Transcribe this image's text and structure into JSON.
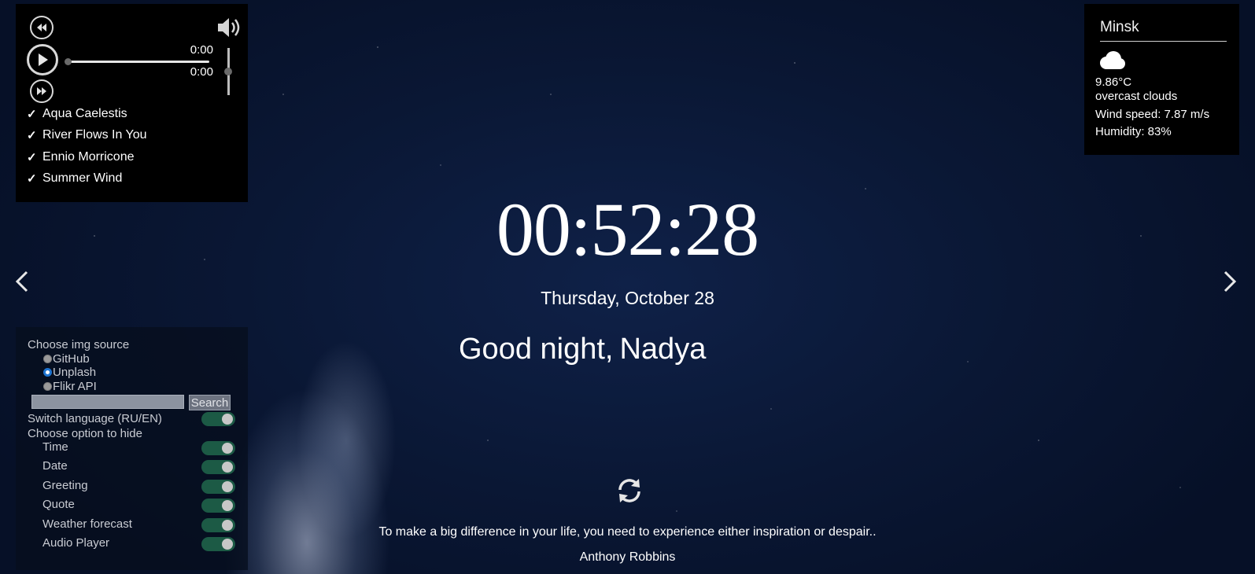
{
  "player": {
    "current_time": "0:00",
    "duration": "0:00",
    "progress_fraction": 0,
    "volume_fraction": 0.5,
    "playlist": [
      {
        "check": "✓",
        "title": "Aqua Caelestis"
      },
      {
        "check": "✓",
        "title": "River Flows In You"
      },
      {
        "check": "✓",
        "title": "Ennio Morricone"
      },
      {
        "check": "✓",
        "title": "Summer Wind"
      }
    ]
  },
  "weather": {
    "city": "Minsk",
    "icon": "cloud-icon",
    "temperature": "9.86°C",
    "description": "overcast clouds",
    "wind": "Wind speed: 7.87 m/s",
    "humidity": "Humidity: 83%"
  },
  "time": "00:52:28",
  "date": "Thursday, October 28",
  "greeting": {
    "text": "Good night,",
    "name": "Nadya"
  },
  "quote": {
    "text": "To make a big difference in your life, you need to experience either inspiration or despair..",
    "author": "Anthony Robbins"
  },
  "settings": {
    "img_source_title": "Choose img source",
    "sources": [
      {
        "label": "GitHub",
        "checked": false
      },
      {
        "label": "Unplash",
        "checked": true
      },
      {
        "label": "Flikr API",
        "checked": false
      }
    ],
    "search_value": "",
    "search_button": "Search",
    "language_label": "Switch language (RU/EN)",
    "language_on": true,
    "hide_title": "Choose option to hide",
    "options": [
      {
        "label": "Time",
        "on": true
      },
      {
        "label": "Date",
        "on": true
      },
      {
        "label": "Greeting",
        "on": true
      },
      {
        "label": "Quote",
        "on": true
      },
      {
        "label": "Weather forecast",
        "on": true
      },
      {
        "label": "Audio Player",
        "on": true
      }
    ]
  },
  "colors": {
    "panel_bg": "#000000",
    "toggle_on": "#1c5a45",
    "radio_accent": "#1f75d1"
  }
}
